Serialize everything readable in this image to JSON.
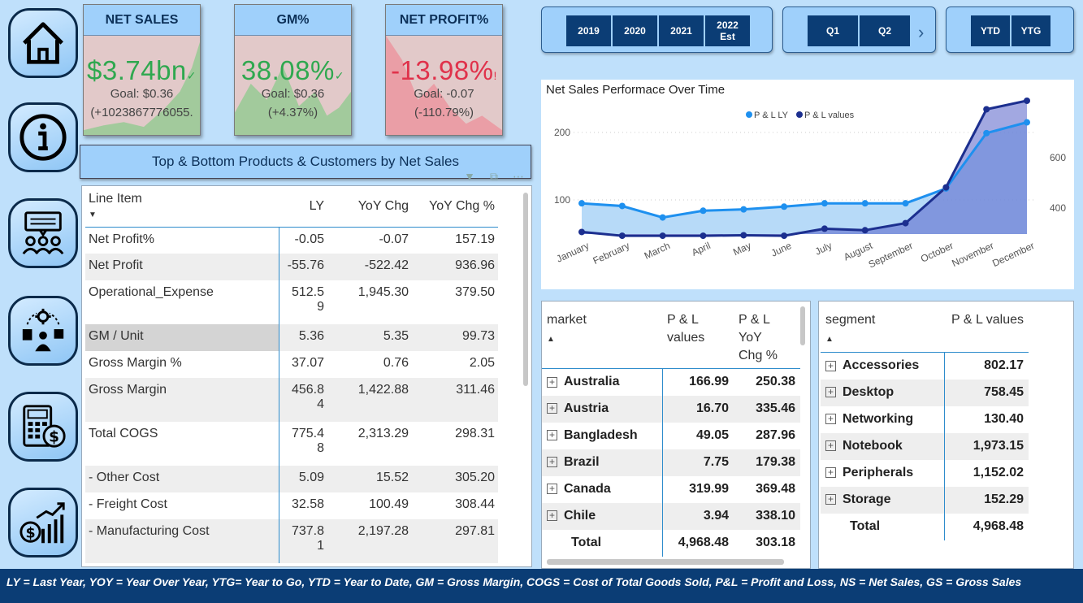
{
  "nav": {
    "items": [
      {
        "name": "home",
        "icon": "home-icon"
      },
      {
        "name": "info",
        "icon": "info-icon"
      },
      {
        "name": "customers",
        "icon": "customer-feedback-icon"
      },
      {
        "name": "operations",
        "icon": "operations-icon"
      },
      {
        "name": "finance",
        "icon": "calculator-money-icon"
      },
      {
        "name": "growth",
        "icon": "growth-chart-icon"
      }
    ]
  },
  "kpis": [
    {
      "title": "NET SALES",
      "value": "$3.74bn",
      "indicator": "✓",
      "goal": "Goal: $0.36",
      "pct": "(+1023867776055.",
      "status": "good",
      "color": "#2fa84f"
    },
    {
      "title": "GM%",
      "value": "38.08%",
      "indicator": "✓",
      "goal": "Goal: $0.36",
      "pct": "(+4.37%)",
      "status": "good",
      "color": "#2fa84f"
    },
    {
      "title": "NET PROFIT%",
      "value": "-13.98%",
      "indicator": "!",
      "goal": "Goal: -0.07",
      "pct": "(-110.79%)",
      "status": "bad",
      "color": "#e0324b"
    }
  ],
  "section_title": "Top & Bottom Products & Customers by Net Sales",
  "main_table": {
    "columns": [
      "Line Item",
      "LY",
      "YoY Chg",
      "YoY Chg %"
    ],
    "rows": [
      {
        "item": "Net Profit%",
        "ly": "-0.05",
        "chg": "-0.07",
        "pct": "157.19"
      },
      {
        "item": "Net Profit",
        "ly": "-55.76",
        "chg": "-522.42",
        "pct": "936.96"
      },
      {
        "item": "Operational_Expense",
        "ly": "512.5\n9",
        "chg": "1,945.30",
        "pct": "379.50"
      },
      {
        "item": "GM / Unit",
        "ly": "5.36",
        "chg": "5.35",
        "pct": "99.73"
      },
      {
        "item": "Gross Margin %",
        "ly": "37.07",
        "chg": "0.76",
        "pct": "2.05"
      },
      {
        "item": "Gross Margin",
        "ly": "456.8\n4",
        "chg": "1,422.88",
        "pct": "311.46"
      },
      {
        "item": "Total COGS",
        "ly": "775.4\n8",
        "chg": "2,313.29",
        "pct": "298.31"
      },
      {
        "item": "- Other Cost",
        "ly": "5.09",
        "chg": "15.52",
        "pct": "305.20"
      },
      {
        "item": "- Freight Cost",
        "ly": "32.58",
        "chg": "100.49",
        "pct": "308.44"
      },
      {
        "item": "- Manufacturing Cost",
        "ly": "737.8\n1",
        "chg": "2,197.28",
        "pct": "297.81"
      }
    ]
  },
  "slicers": {
    "years": [
      "2019",
      "2020",
      "2021",
      "2022\nEst"
    ],
    "quarters": [
      "Q1",
      "Q2"
    ],
    "periods": [
      "YTD",
      "YTG"
    ]
  },
  "chart_data": {
    "type": "area",
    "title": "Net Sales Performace Over Time",
    "categories": [
      "January",
      "February",
      "March",
      "April",
      "May",
      "June",
      "July",
      "August",
      "September",
      "October",
      "November",
      "December"
    ],
    "series": [
      {
        "name": "P & L LY",
        "axis": "left",
        "color": "#1e90ef",
        "values": [
          95,
          91,
          74,
          84,
          86,
          90,
          95,
          95,
          95,
          117,
          199,
          215
        ]
      },
      {
        "name": "P & L values",
        "axis": "right",
        "color": "#1c2f8f",
        "values": [
          305,
          290,
          290,
          290,
          292,
          290,
          318,
          312,
          340,
          482,
          792,
          826
        ]
      }
    ],
    "y_left_ticks": [
      100,
      200
    ],
    "y_right_ticks": [
      400,
      600
    ],
    "legend": "top-center"
  },
  "market_table": {
    "columns": [
      "market",
      "P & L\nvalues",
      "P & L YoY\nChg %"
    ],
    "rows": [
      {
        "label": "Australia",
        "values": "166.99",
        "chg": "250.38"
      },
      {
        "label": "Austria",
        "values": "16.70",
        "chg": "335.46"
      },
      {
        "label": "Bangladesh",
        "values": "49.05",
        "chg": "287.96"
      },
      {
        "label": "Brazil",
        "values": "7.75",
        "chg": "179.38"
      },
      {
        "label": "Canada",
        "values": "319.99",
        "chg": "369.48"
      },
      {
        "label": "Chile",
        "values": "3.94",
        "chg": "338.10"
      }
    ],
    "total": {
      "label": "Total",
      "values": "4,968.48",
      "chg": "303.18"
    }
  },
  "segment_table": {
    "columns": [
      "segment",
      "P & L values"
    ],
    "rows": [
      {
        "label": "Accessories",
        "values": "802.17"
      },
      {
        "label": "Desktop",
        "values": "758.45"
      },
      {
        "label": "Networking",
        "values": "130.40"
      },
      {
        "label": "Notebook",
        "values": "1,973.15"
      },
      {
        "label": "Peripherals",
        "values": "1,152.02"
      },
      {
        "label": "Storage",
        "values": "152.29"
      }
    ],
    "total": {
      "label": "Total",
      "values": "4,968.48"
    }
  },
  "footer": "LY = Last Year, YOY = Year Over Year, YTG= Year to Go, YTD = Year to Date, GM = Gross Margin, COGS = Cost of Total Goods Sold, P&L = Profit and Loss, NS = Net Sales, GS = Gross Sales"
}
